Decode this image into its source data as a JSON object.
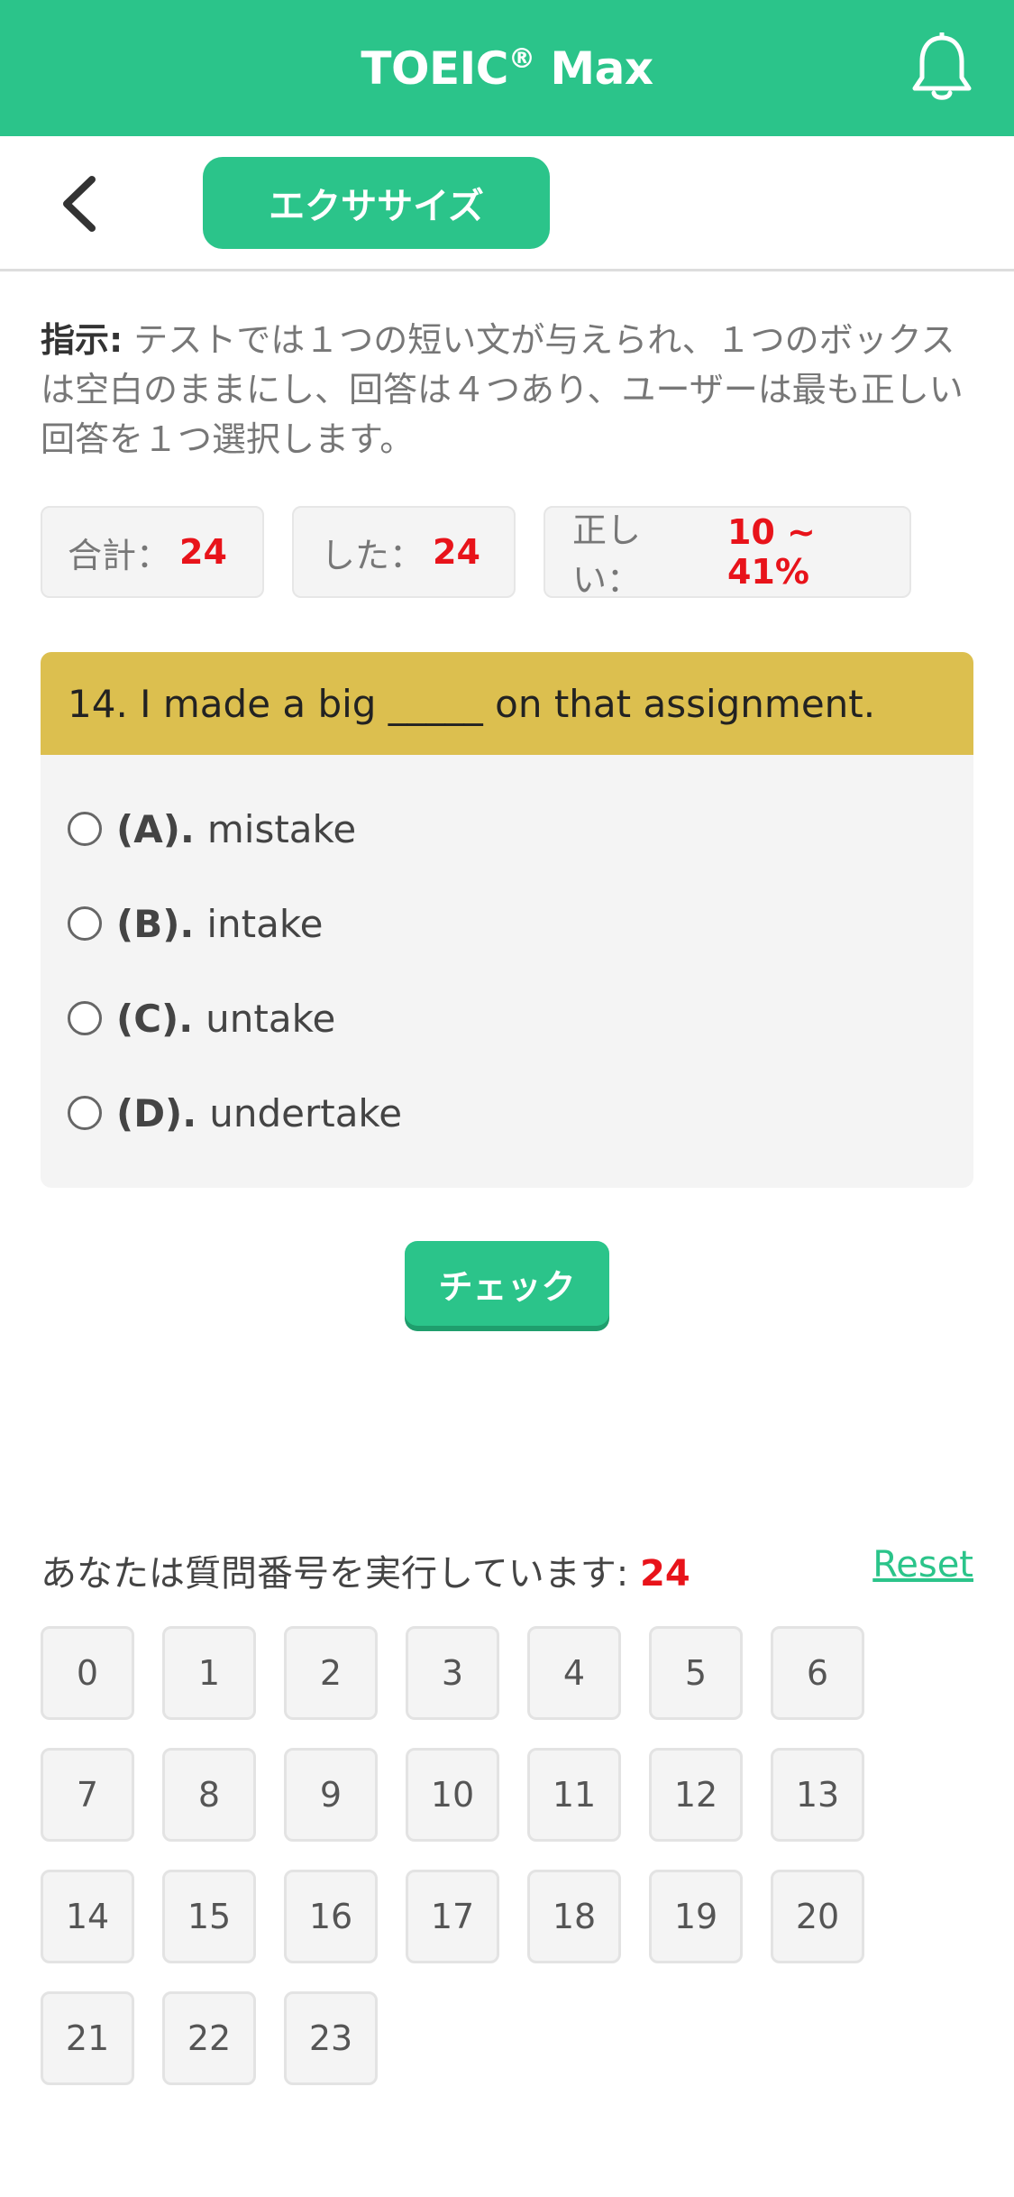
{
  "app": {
    "title": "TOEIC",
    "title_mark": "®",
    "title_suffix": " Max",
    "accent_color": "#2bc48a"
  },
  "header": {
    "back_icon": "chevron-left-icon",
    "tab_label": "エクササイズ",
    "bell_icon": "bell-icon"
  },
  "instructions": {
    "label": "指示:",
    "text": " テストでは１つの短い文が与えられ、１つのボックスは空白のままにし、回答は４つあり、ユーザーは最も正しい回答を１つ選択します。"
  },
  "stats": [
    {
      "label": "合計：",
      "value": "24"
    },
    {
      "label": "した：",
      "value": "24"
    },
    {
      "label": "正しい：",
      "value": "10 ~ 41%"
    }
  ],
  "question": {
    "text": "14. I made a big _____ on that assignment.",
    "options": [
      {
        "letter": "(A).",
        "text": "mistake"
      },
      {
        "letter": "(B).",
        "text": "intake"
      },
      {
        "letter": "(C).",
        "text": "untake"
      },
      {
        "letter": "(D).",
        "text": "undertake"
      }
    ]
  },
  "check_label": "チェック",
  "progress": {
    "label": "あなたは質問番号を実行しています: ",
    "current": "24",
    "reset": "Reset"
  },
  "question_numbers": [
    "0",
    "1",
    "2",
    "3",
    "4",
    "5",
    "6",
    "7",
    "8",
    "9",
    "10",
    "11",
    "12",
    "13",
    "14",
    "15",
    "16",
    "17",
    "18",
    "19",
    "20",
    "21",
    "22",
    "23"
  ]
}
